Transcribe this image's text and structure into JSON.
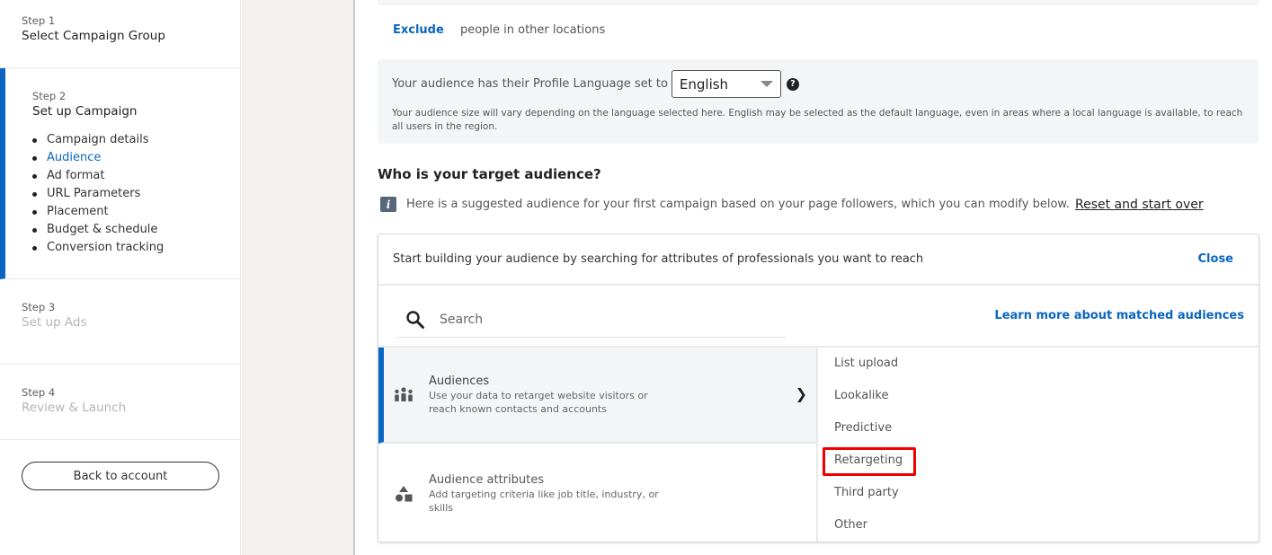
{
  "sidebar": {
    "steps": [
      {
        "num": "Step 1",
        "title": "Select Campaign Group"
      },
      {
        "num": "Step 2",
        "title": "Set up Campaign",
        "substeps": [
          {
            "label": "Campaign details"
          },
          {
            "label": "Audience",
            "active": true
          },
          {
            "label": "Ad format"
          },
          {
            "label": "URL Parameters"
          },
          {
            "label": "Placement"
          },
          {
            "label": "Budget & schedule"
          },
          {
            "label": "Conversion tracking"
          }
        ]
      },
      {
        "num": "Step 3",
        "title": "Set up Ads"
      },
      {
        "num": "Step 4",
        "title": "Review & Launch"
      }
    ],
    "back_button": "Back to account"
  },
  "location": {
    "exclude_label": "Exclude",
    "exclude_text": "people in other locations"
  },
  "language": {
    "prefix": "Your audience has their Profile Language set to",
    "selected": "English",
    "help_icon": "?",
    "note": "Your audience size will vary depending on the language selected here. English may be selected as the default language, even in areas where a local language is available, to reach all users in the region."
  },
  "target": {
    "heading": "Who is your target audience?",
    "info_icon": "i",
    "info_text": "Here is a suggested audience for your first campaign based on your page followers, which you can modify below.",
    "reset_link": "Reset and start over"
  },
  "builder": {
    "intro": "Start building your audience by searching for attributes of professionals you want to reach",
    "close_label": "Close",
    "search_placeholder": "Search",
    "learn_more": "Learn more about matched audiences",
    "categories": [
      {
        "title": "Audiences",
        "description": "Use your data to retarget website visitors or reach known contacts and accounts",
        "selected": true,
        "chevron": "❯"
      },
      {
        "title": "Audience attributes",
        "description": "Add targeting criteria like job title, industry, or skills",
        "selected": false
      }
    ],
    "subitems": [
      "List upload",
      "Lookalike",
      "Predictive",
      "Retargeting",
      "Third party",
      "Other"
    ],
    "highlighted_subitem": "Retargeting"
  },
  "colors": {
    "accent": "#0a66c2",
    "highlight": "#ee0000"
  }
}
